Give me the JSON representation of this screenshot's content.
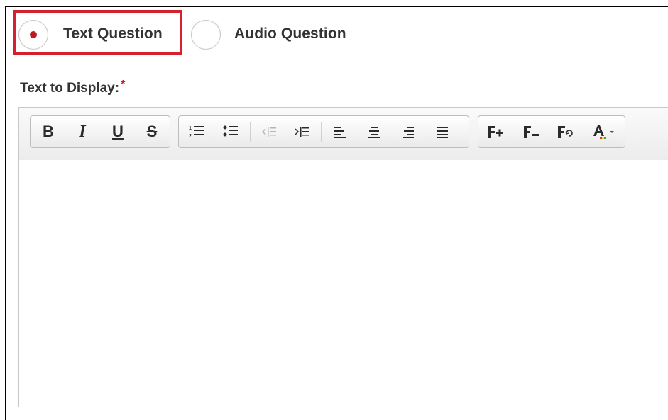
{
  "question_type": {
    "options": [
      {
        "label": "Text Question",
        "selected": true
      },
      {
        "label": "Audio Question",
        "selected": false
      }
    ]
  },
  "field": {
    "label": "Text to Display:",
    "required_mark": "*"
  },
  "toolbar": {
    "bold": "B",
    "italic": "I",
    "underline": "U",
    "strikethrough": "S"
  },
  "colors": {
    "highlight": "#d3222e",
    "radio_dot": "#c0181f"
  }
}
